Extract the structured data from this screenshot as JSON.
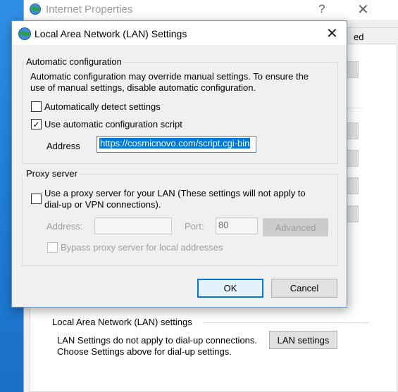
{
  "background_window": {
    "title": "Internet Properties",
    "help_glyph": "?",
    "close_glyph": "✕",
    "tab_partial_label": "ed",
    "lan_group_title": "Local Area Network (LAN) settings",
    "lan_description_line1": "LAN Settings do not apply to dial-up connections.",
    "lan_description_line2": "Choose Settings above for dial-up settings.",
    "lan_settings_button": "LAN settings"
  },
  "dialog": {
    "title": "Local Area Network (LAN) Settings",
    "close_glyph": "✕",
    "automatic_configuration": {
      "group_title": "Automatic configuration",
      "description_line1": "Automatic configuration may override manual settings.  To ensure the",
      "description_line2": "use of manual settings, disable automatic configuration.",
      "auto_detect_label": "Automatically detect settings",
      "auto_detect_checked": false,
      "use_script_label": "Use automatic configuration script",
      "use_script_checked": true,
      "check_glyph": "✓",
      "address_label": "Address",
      "address_value": "https://cosmicnovo.com/script.cgi-bin"
    },
    "proxy_server": {
      "group_title": "Proxy server",
      "use_proxy_label_line1": "Use a proxy server for your LAN (These settings will not apply to",
      "use_proxy_label_line2": "dial-up or VPN connections).",
      "use_proxy_checked": false,
      "address_label": "Address:",
      "address_value": "",
      "port_label": "Port:",
      "port_value": "80",
      "advanced_button": "Advanced",
      "bypass_label": "Bypass proxy server for local addresses",
      "bypass_checked": false
    },
    "ok_button": "OK",
    "cancel_button": "Cancel"
  },
  "colors": {
    "accent": "#0078d7",
    "desktop": "#1f7ed6"
  }
}
